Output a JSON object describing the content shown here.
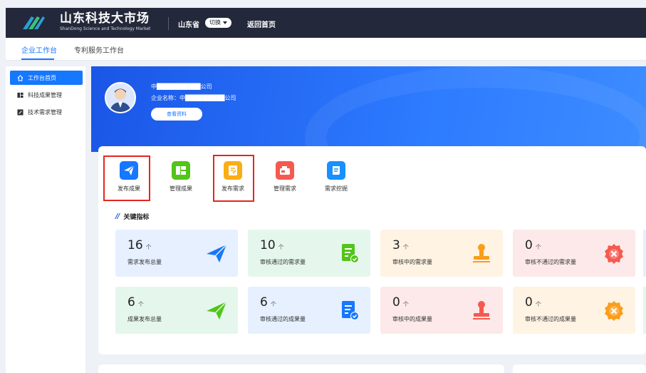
{
  "header": {
    "brand_cn": "山东科技大市场",
    "brand_en": "ShanDong Science and Technology Market",
    "province": "山东省",
    "switch_label": "切换",
    "home_link": "返回首页"
  },
  "tabs": [
    {
      "label": "企业工作台",
      "active": true
    },
    {
      "label": "专利服务工作台",
      "active": false
    }
  ],
  "sidebar": {
    "items": [
      {
        "label": "工作台首页",
        "icon": "home-icon",
        "active": true
      },
      {
        "label": "科技成果管理",
        "icon": "grid-icon",
        "active": false
      },
      {
        "label": "技术需求管理",
        "icon": "edit-icon",
        "active": false
      }
    ]
  },
  "profile": {
    "line1": "中██████████公司",
    "company_label": "企业名称：",
    "company_value": "中█████████公司",
    "view_button": "查看资料"
  },
  "quick_actions": [
    {
      "label": "发布成果",
      "icon": "send-icon",
      "color": "#1677ff",
      "highlighted": true
    },
    {
      "label": "管理成果",
      "icon": "folder-icon",
      "color": "#52c41a",
      "highlighted": false
    },
    {
      "label": "发布需求",
      "icon": "publish-demand-icon",
      "color": "#faad14",
      "highlighted": true
    },
    {
      "label": "管理需求",
      "icon": "manage-demand-icon",
      "color": "#f5594f",
      "highlighted": false
    },
    {
      "label": "需求挖掘",
      "icon": "document-icon",
      "color": "#1890ff",
      "highlighted": false
    }
  ],
  "indicators": {
    "title": "关键指标",
    "unit": "个",
    "rows": [
      [
        {
          "value": "16",
          "label": "需求发布总量",
          "bg": "#e6f0ff",
          "icon": "paper-plane-icon",
          "icon_color": "#1677ff"
        },
        {
          "value": "10",
          "label": "审核通过的需求量",
          "bg": "#e5f7ec",
          "icon": "approved-doc-icon",
          "icon_color": "#52c41a"
        },
        {
          "value": "3",
          "label": "审核中的需求量",
          "bg": "#fff3e3",
          "icon": "stamp-icon",
          "icon_color": "#fa9d1a"
        },
        {
          "value": "0",
          "label": "审核不通过的需求量",
          "bg": "#fde9e9",
          "icon": "rejected-badge-icon",
          "icon_color": "#f5594f"
        }
      ],
      [
        {
          "value": "6",
          "label": "成果发布总量",
          "bg": "#e5f7ec",
          "icon": "paper-plane-icon",
          "icon_color": "#52c41a"
        },
        {
          "value": "6",
          "label": "审核通过的成果量",
          "bg": "#e6f0ff",
          "icon": "approved-doc-icon",
          "icon_color": "#1677ff"
        },
        {
          "value": "0",
          "label": "审核中的成果量",
          "bg": "#fde9e9",
          "icon": "stamp-icon",
          "icon_color": "#f5594f"
        },
        {
          "value": "0",
          "label": "审核不通过的成果量",
          "bg": "#fff3e3",
          "icon": "rejected-badge-icon",
          "icon_color": "#fa9d1a"
        }
      ]
    ]
  }
}
